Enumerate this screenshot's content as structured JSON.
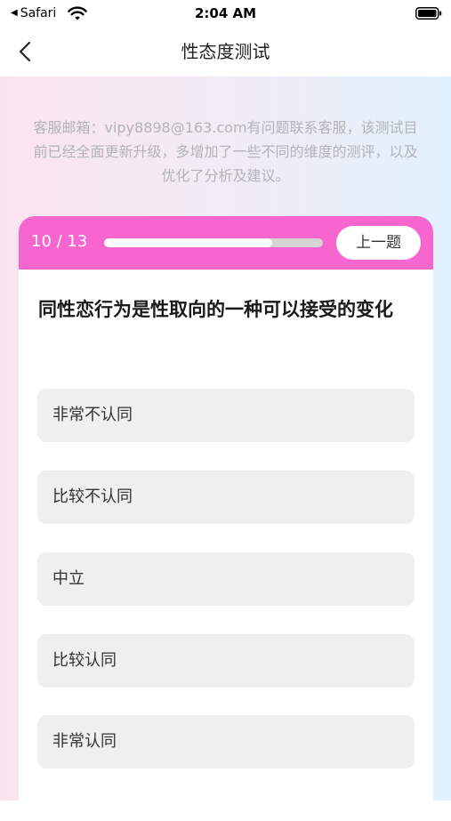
{
  "status_bar": {
    "back_app": "Safari",
    "time": "2:04 AM"
  },
  "nav": {
    "title": "性态度测试"
  },
  "notice": "客服邮箱：vipy8898@163.com有问题联系客服，该测试目前已经全面更新升级，多增加了一些不同的维度的测评，以及优化了分析及建议。",
  "quiz": {
    "progress_text": "10 / 13",
    "current": 10,
    "total": 13,
    "prev_label": "上一题",
    "question": "同性恋行为是性取向的一种可以接受的变化",
    "options": [
      "非常不认同",
      "比较不认同",
      "中立",
      "比较认同",
      "非常认同"
    ]
  },
  "colors": {
    "accent": "#f766cf",
    "option_bg": "#efefef",
    "notice_text": "#b3b3b8"
  },
  "icons": [
    "back-chevron-icon",
    "wifi-icon",
    "battery-icon"
  ]
}
